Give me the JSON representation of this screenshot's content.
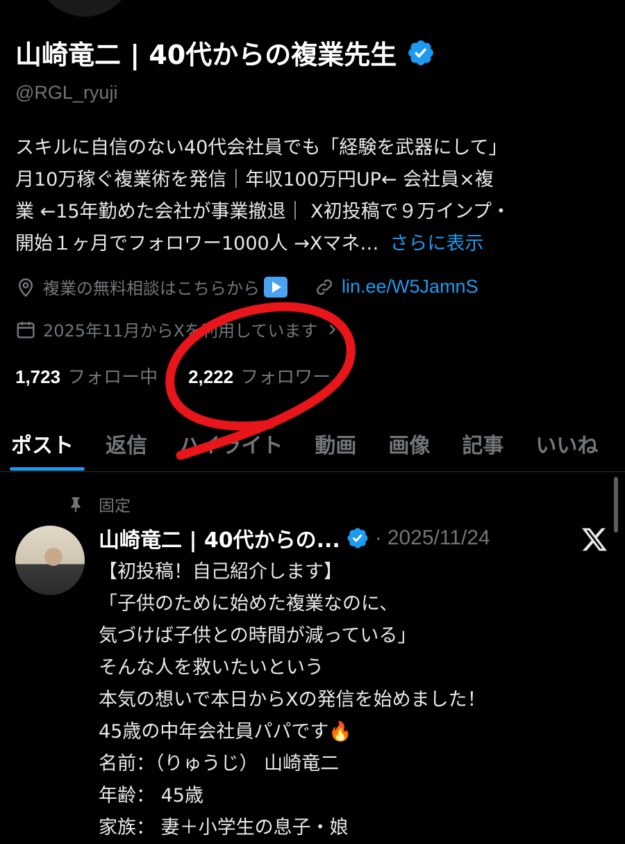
{
  "profile": {
    "display_name": "山崎竜二 | 40代からの複業先生",
    "handle": "@RGL_ryuji",
    "bio_lines": [
      "スキルに自信のない40代会社員でも「経験を武器にして」",
      "月10万稼ぐ複業術を発信｜年収100万円UP← 会社員×複",
      "業 ←15年勤めた会社が事業撤退｜ X初投稿で９万インプ・",
      "開始１ヶ月でフォロワー1000人 →Xマネ…"
    ],
    "show_more": "さらに表示",
    "location_text": "複業の無料相談はこちらから",
    "link_text": "lin.ee/W5JamnS",
    "joined_text": "2025年11月からXを利用しています",
    "following_count": "1,723",
    "following_label": "フォロー中",
    "followers_count": "2,222",
    "followers_label": "フォロワー"
  },
  "tabs": [
    {
      "label": "ポスト"
    },
    {
      "label": "返信"
    },
    {
      "label": "ハイライト"
    },
    {
      "label": "動画"
    },
    {
      "label": "画像"
    },
    {
      "label": "記事"
    },
    {
      "label": "いいね"
    }
  ],
  "post": {
    "pinned_label": "固定",
    "author_name": "山崎竜二 | 40代からの...",
    "separator": "·",
    "date": "2025/11/24",
    "lines": [
      "【初投稿！自己紹介します】",
      "「子供のために始めた複業なのに、",
      "気づけば子供との時間が減っている」",
      "そんな人を救いたいという",
      "本気の想いで本日からXの発信を始めました！",
      "45歳の中年会社員パパです🔥",
      "名前：（りゅうじ） 山崎竜二",
      "年齢： 45歳",
      "家族： 妻＋小学生の息子・娘"
    ]
  },
  "colors": {
    "accent": "#1d9bf0",
    "muted": "#71767b",
    "annotation": "#e8151b"
  },
  "icons": [
    "verified-badge-icon",
    "location-pin-icon",
    "link-icon",
    "calendar-icon",
    "chevron-right-icon",
    "pin-icon",
    "x-logo-icon",
    "play-button-icon"
  ]
}
